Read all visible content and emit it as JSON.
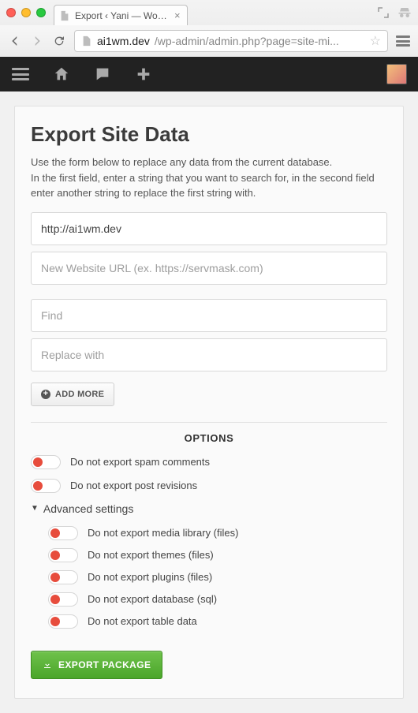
{
  "browser": {
    "tab_title": "Export ‹ Yani — WordPress",
    "url_host": "ai1wm.dev",
    "url_path": "/wp-admin/admin.php?page=site-mi..."
  },
  "page": {
    "title": "Export Site Data",
    "intro_line1": "Use the form below to replace any data from the current database.",
    "intro_line2": "In the first field, enter a string that you want to search for, in the second field enter another string to replace the first string with."
  },
  "replace_group": {
    "old_url_value": "http://ai1wm.dev",
    "new_url_placeholder": "New Website URL (ex. https://servmask.com)"
  },
  "find_group": {
    "find_placeholder": "Find",
    "replace_placeholder": "Replace with"
  },
  "buttons": {
    "add_more": "ADD MORE",
    "export": "EXPORT PACKAGE"
  },
  "options": {
    "heading": "OPTIONS",
    "spam_label": "Do not export spam comments",
    "revisions_label": "Do not export post revisions",
    "advanced_label": "Advanced settings",
    "media_label": "Do not export media library (files)",
    "themes_label": "Do not export themes (files)",
    "plugins_label": "Do not export plugins (files)",
    "database_label": "Do not export database (sql)",
    "tabledata_label": "Do not export table data"
  }
}
